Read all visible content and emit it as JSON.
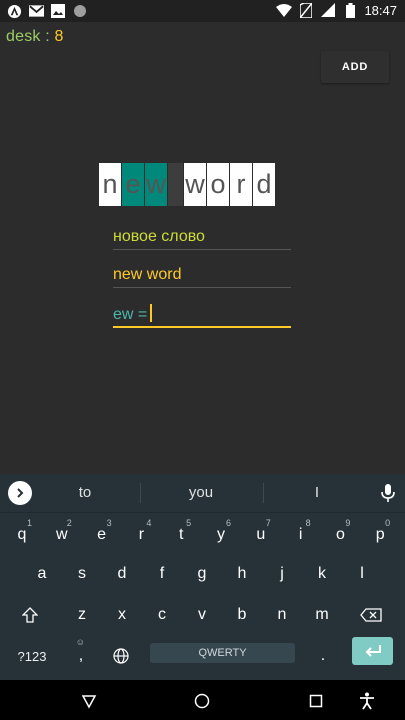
{
  "status_bar": {
    "time": "18:47",
    "icons": [
      "app-a-icon",
      "gmail-icon",
      "image-icon",
      "circle-dot-icon",
      "wifi-icon",
      "no-sim-icon",
      "signal-icon",
      "battery-icon"
    ]
  },
  "app": {
    "counter_label": "desk :",
    "counter_value": "8",
    "add_button": "ADD",
    "tiles": [
      "n",
      "e",
      "w",
      "",
      "w",
      "o",
      "r",
      "d"
    ],
    "tile_styles": [
      "white",
      "teal",
      "teal",
      "gap",
      "white",
      "white",
      "white",
      "white"
    ],
    "translation": "новое слово",
    "word": "new word",
    "input_value": "ew ="
  },
  "keyboard": {
    "suggestions": [
      "to",
      "you",
      "I"
    ],
    "row1": [
      {
        "k": "q",
        "h": "1"
      },
      {
        "k": "w",
        "h": "2"
      },
      {
        "k": "e",
        "h": "3"
      },
      {
        "k": "r",
        "h": "4"
      },
      {
        "k": "t",
        "h": "5"
      },
      {
        "k": "y",
        "h": "6"
      },
      {
        "k": "u",
        "h": "7"
      },
      {
        "k": "i",
        "h": "8"
      },
      {
        "k": "o",
        "h": "9"
      },
      {
        "k": "p",
        "h": "0"
      }
    ],
    "row2": [
      "a",
      "s",
      "d",
      "f",
      "g",
      "h",
      "j",
      "k",
      "l"
    ],
    "row3": [
      "z",
      "x",
      "c",
      "v",
      "b",
      "n",
      "m"
    ],
    "symbols_key": "?123",
    "comma_key": ",",
    "space_label": "QWERTY",
    "period_key": "."
  },
  "colors": {
    "accent": "#00897b",
    "translation": "#cddc39",
    "word": "#ffca28",
    "input": "#4db6ac",
    "enter": "#80cbc4"
  }
}
